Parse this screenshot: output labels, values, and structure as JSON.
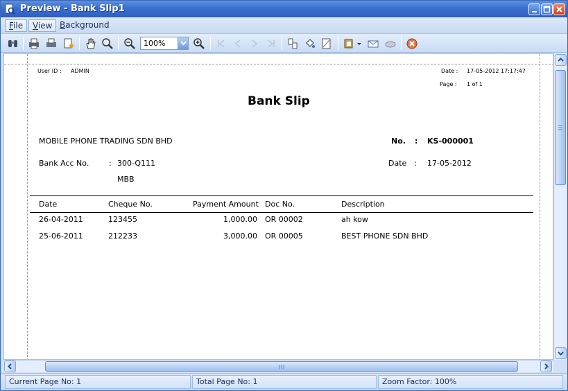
{
  "window": {
    "title": "Preview - Bank Slip1"
  },
  "menu": [
    {
      "label": "File",
      "u": "F",
      "rest": "ile"
    },
    {
      "label": "View",
      "u": "V",
      "rest": "iew"
    },
    {
      "label": "Background",
      "u": "B",
      "rest": "ackground"
    }
  ],
  "toolbar": {
    "zoom_value": "100%"
  },
  "report": {
    "user_label": "User ID :",
    "user_value": "ADMIN",
    "date_label": "Date :",
    "date_value": "17-05-2012 17:17:47",
    "page_label": "Page :",
    "page_value": "1 of 1",
    "title": "Bank Slip",
    "company": "MOBILE PHONE TRADING SDN BHD",
    "no_label": "No.",
    "colon": ":",
    "no_value": "KS-000001",
    "bank_acc_label": "Bank Acc No.",
    "bank_acc_value": "300-Q111",
    "bank_name": "MBB",
    "slip_date_label": "Date",
    "slip_date_value": "17-05-2012",
    "columns": [
      "Date",
      "Cheque No.",
      "Payment Amount",
      "Doc No.",
      "Description"
    ],
    "rows": [
      {
        "date": "26-04-2011",
        "cheque": "123455",
        "amount": "1,000.00",
        "doc": "OR 00002",
        "desc": "ah kow"
      },
      {
        "date": "25-06-2011",
        "cheque": "212233",
        "amount": "3,000.00",
        "doc": "OR 00005",
        "desc": "BEST PHONE SDN BHD"
      }
    ]
  },
  "status": {
    "current_page": "Current Page No: 1",
    "total_page": "Total Page No: 1",
    "zoom_factor": "Zoom Factor: 100%"
  }
}
